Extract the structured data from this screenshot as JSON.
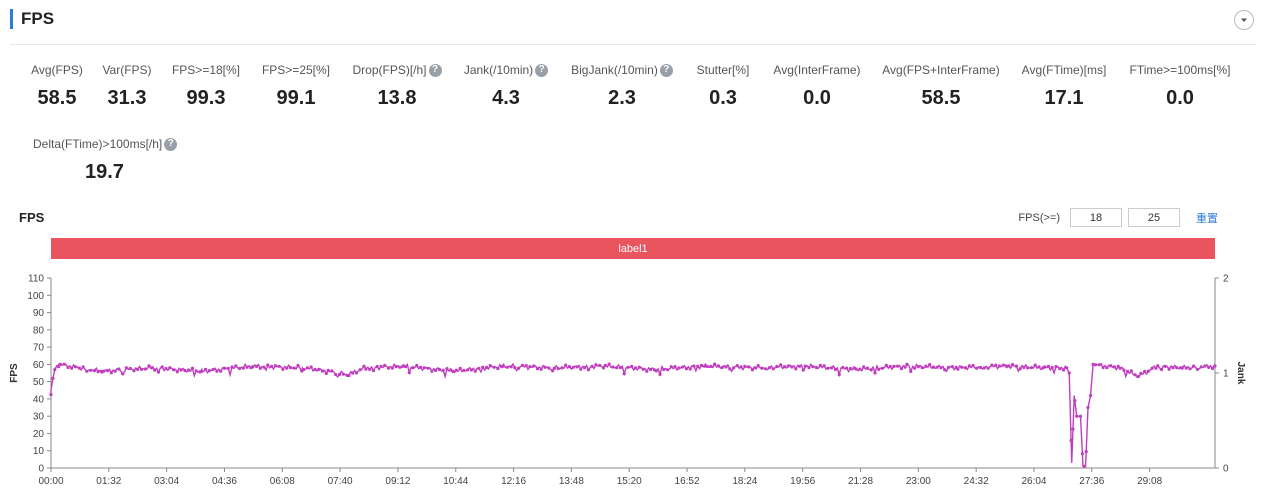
{
  "header": {
    "title": "FPS"
  },
  "metrics": [
    {
      "label": "Avg(FPS)",
      "value": "58.5",
      "help": false
    },
    {
      "label": "Var(FPS)",
      "value": "31.3",
      "help": false
    },
    {
      "label": "FPS>=18[%]",
      "value": "99.3",
      "help": false
    },
    {
      "label": "FPS>=25[%]",
      "value": "99.1",
      "help": false
    },
    {
      "label": "Drop(FPS)[/h]",
      "value": "13.8",
      "help": true
    },
    {
      "label": "Jank(/10min)",
      "value": "4.3",
      "help": true
    },
    {
      "label": "BigJank(/10min)",
      "value": "2.3",
      "help": true
    },
    {
      "label": "Stutter[%]",
      "value": "0.3",
      "help": false
    },
    {
      "label": "Avg(InterFrame)",
      "value": "0.0",
      "help": false
    },
    {
      "label": "Avg(FPS+InterFrame)",
      "value": "58.5",
      "help": false
    },
    {
      "label": "Avg(FTime)[ms]",
      "value": "17.1",
      "help": false
    },
    {
      "label": "FTime>=100ms[%]",
      "value": "0.0",
      "help": false
    },
    {
      "label": "Delta(FTime)>100ms[/h]",
      "value": "19.7",
      "help": true
    }
  ],
  "chart_header": {
    "title": "FPS",
    "threshold_label": "FPS(>=)",
    "threshold_low": "18",
    "threshold_high": "25",
    "reset_label": "重置"
  },
  "label_band": {
    "text": "label1",
    "color": "#e9545f"
  },
  "chart_data": {
    "type": "line",
    "title": "FPS",
    "xlabel": "",
    "ylabel": "FPS",
    "y2label": "Jank",
    "ylim": [
      0,
      110
    ],
    "y2lim": [
      0,
      2
    ],
    "yticks": [
      0,
      10,
      20,
      30,
      40,
      50,
      60,
      70,
      80,
      90,
      100,
      110
    ],
    "y2ticks": [
      0,
      1,
      2
    ],
    "xticks": [
      "00:00",
      "01:32",
      "03:04",
      "04:36",
      "06:08",
      "07:40",
      "09:12",
      "10:44",
      "12:16",
      "13:48",
      "15:20",
      "16:52",
      "18:24",
      "19:56",
      "21:28",
      "23:00",
      "24:32",
      "26:04",
      "27:36",
      "29:08"
    ],
    "x_unit": "seconds",
    "x_range": [
      0,
      1852
    ],
    "series": [
      {
        "color": "#c03dbf",
        "baseline": 59,
        "points": [
          [
            0,
            45
          ],
          [
            6,
            57
          ],
          [
            12,
            60
          ],
          [
            80,
            56
          ],
          [
            160,
            58
          ],
          [
            240,
            56
          ],
          [
            320,
            59
          ],
          [
            400,
            58
          ],
          [
            440,
            56
          ],
          [
            472,
            54
          ],
          [
            500,
            58
          ],
          [
            560,
            59
          ],
          [
            640,
            56
          ],
          [
            720,
            59
          ],
          [
            800,
            58
          ],
          [
            880,
            59
          ],
          [
            960,
            57
          ],
          [
            1040,
            59
          ],
          [
            1120,
            58
          ],
          [
            1200,
            59
          ],
          [
            1280,
            57
          ],
          [
            1360,
            59
          ],
          [
            1440,
            58
          ],
          [
            1520,
            59
          ],
          [
            1580,
            58
          ],
          [
            1616,
            58
          ],
          [
            1620,
            55
          ],
          [
            1624,
            3
          ],
          [
            1628,
            42
          ],
          [
            1632,
            30
          ],
          [
            1638,
            30
          ],
          [
            1642,
            1
          ],
          [
            1646,
            1
          ],
          [
            1650,
            35
          ],
          [
            1654,
            42
          ],
          [
            1658,
            60
          ],
          [
            1700,
            58
          ],
          [
            1730,
            53
          ],
          [
            1760,
            59
          ],
          [
            1800,
            58
          ],
          [
            1852,
            59
          ]
        ]
      }
    ],
    "grid": false,
    "legend": "none"
  }
}
